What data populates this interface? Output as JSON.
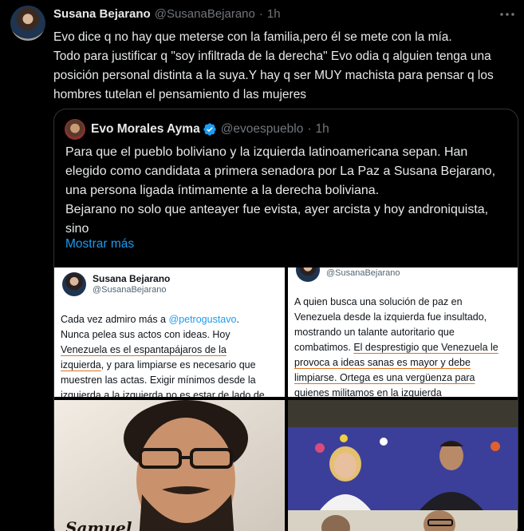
{
  "tweet": {
    "author_name": "Susana Bejarano",
    "author_handle": "@SusanaBejarano",
    "separator": "·",
    "time": "1h",
    "text": "Evo dice q no hay que meterse con la familia,pero él se mete con la mía.\nTodo para justificar q \"soy infiltrada de la derecha\" Evo odia q alguien tenga una posición personal distinta a la suya.Y hay q ser MUY machista para pensar q los hombres tutelan el pensamiento d las mujeres"
  },
  "quote": {
    "author_name": "Evo Morales Ayma",
    "author_handle": "@evoespueblo",
    "separator": "·",
    "time": "1h",
    "text": "Para que el pueblo boliviano y la izquierda latinoamericana sepan. Han elegido como candidata a primera senadora por La Paz a Susana Bejarano, una persona ligada íntimamente a la derecha boliviana.\nBejarano no solo que anteayer fue evista, ayer arcista y hoy androniquista, sino",
    "show_more": "Mostrar más"
  },
  "media": {
    "panel1": {
      "name": "Susana Bejarano",
      "handle": "@SusanaBejarano",
      "text_a": "Cada vez admiro más a ",
      "mention": "@petrogustavo",
      "text_b": ".\nNunca pelea sus actos con ideas. Hoy\n",
      "underline_1": "Venezuela es el espantapájaros de la",
      "underline_2": "izquierda",
      "text_c": ", y para limpiarse es necesario que\nmuestren las actas. Exigir mínimos desde la\nizquierda a la izquierda no es estar de lado de"
    },
    "panel2": {
      "handle": "@SusanaBejarano",
      "text_a": "A quien busca una solución de paz en\nVenezuela desde la izquierda fue insultado,\nmostrando un talante autoritario que\ncombatimos. ",
      "underline_1": "El desprestigio que Venezuela le",
      "underline_2": "provoca a ideas sanas es mayor y debe",
      "underline_3": "limpiarse. Ortega es una vergüenza para",
      "text_b": "\nquienes militamos en la izquierda"
    },
    "panel3": {
      "caption": "Samuel"
    }
  },
  "colors": {
    "background": "#000000",
    "text": "#e7e9ea",
    "muted": "#71767b",
    "link": "#1d9bf0",
    "verified": "#1d9bf0"
  },
  "icons": {
    "more": "more-horizontal-icon",
    "verified": "verified-badge-icon"
  }
}
